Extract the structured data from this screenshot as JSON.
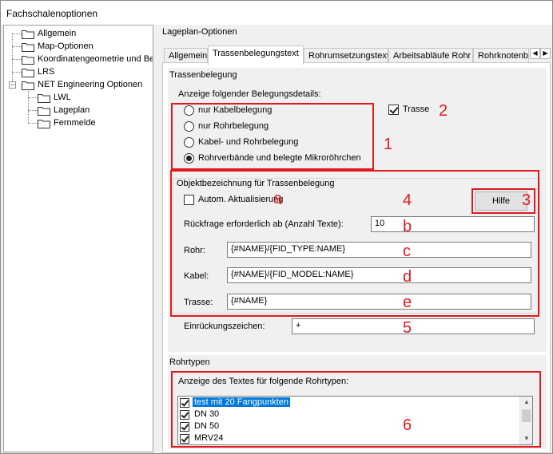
{
  "window": {
    "title": "Fachschalenoptionen"
  },
  "tree": {
    "items": [
      {
        "label": "Allgemein"
      },
      {
        "label": "Map-Optionen"
      },
      {
        "label": "Koordinatengeometrie und Ber"
      },
      {
        "label": "LRS"
      },
      {
        "label": "NET Engineering Optionen",
        "expanded": true
      },
      {
        "label": "LWL"
      },
      {
        "label": "Lageplan"
      },
      {
        "label": "Fernmelde"
      }
    ],
    "expander_symbol": "−"
  },
  "panel": {
    "title": "Lageplan-Optionen"
  },
  "tabs": [
    {
      "label": "Allgemein",
      "active": false
    },
    {
      "label": "Trassenbelegungstext",
      "active": true
    },
    {
      "label": "Rohrumsetzungstext",
      "active": false
    },
    {
      "label": "Arbeitsabläufe Rohr",
      "active": false
    },
    {
      "label": "Rohrknotenbel",
      "active": false
    }
  ],
  "tab_scroll": {
    "left": "◀",
    "right": "▶"
  },
  "trassenbelegung": {
    "group_title": "Trassenbelegung",
    "details_label": "Anzeige folgender Belegungsdetails:",
    "radios": [
      {
        "label": "nur Kabelbelegung",
        "selected": false
      },
      {
        "label": "nur Rohrbelegung",
        "selected": false
      },
      {
        "label": "Kabel- und Rohrbelegung",
        "selected": false
      },
      {
        "label": "Rohrverbände und belegte Mikroröhrchen",
        "selected": true
      }
    ],
    "trasse_checkbox": {
      "label": "Trasse",
      "checked": true
    }
  },
  "objektbezeichnung": {
    "group_title": "Objektbezeichnung für Trassenbelegung",
    "auto_update": {
      "label": "Autom. Aktualisierung",
      "checked": false
    },
    "help_button": "Hilfe",
    "rueckfrage_label": "Rückfrage erforderlich ab (Anzahl Texte):",
    "rueckfrage_value": "10",
    "rohr_label": "Rohr:",
    "rohr_value": "{#NAME}/{FID_TYPE:NAME}",
    "kabel_label": "Kabel:",
    "kabel_value": "{#NAME}/{FID_MODEL:NAME}",
    "trasse_label": "Trasse:",
    "trasse_value": "{#NAME}"
  },
  "einrueckung": {
    "label": "Einrückungszeichen:",
    "value": "+"
  },
  "rohrtypen": {
    "group_title": "Rohrtypen",
    "list_label": "Anzeige des Textes für folgende Rohrtypen:",
    "items": [
      {
        "label": "test mit 20 Fangpunkten",
        "checked": true,
        "selected": true
      },
      {
        "label": "DN 30",
        "checked": true,
        "selected": false
      },
      {
        "label": "DN 50",
        "checked": true,
        "selected": false
      },
      {
        "label": "MRV24",
        "checked": true,
        "selected": false
      }
    ],
    "scroll_up": "▲",
    "scroll_down": "▼"
  },
  "annotations": {
    "n1": "1",
    "n2": "2",
    "n3": "3",
    "n4": "4",
    "n5": "5",
    "n6": "6",
    "a": "a",
    "b": "b",
    "c": "c",
    "d": "d",
    "e": "e"
  },
  "colors": {
    "annotation_red": "#e0191f",
    "selection_blue": "#0078d7"
  }
}
